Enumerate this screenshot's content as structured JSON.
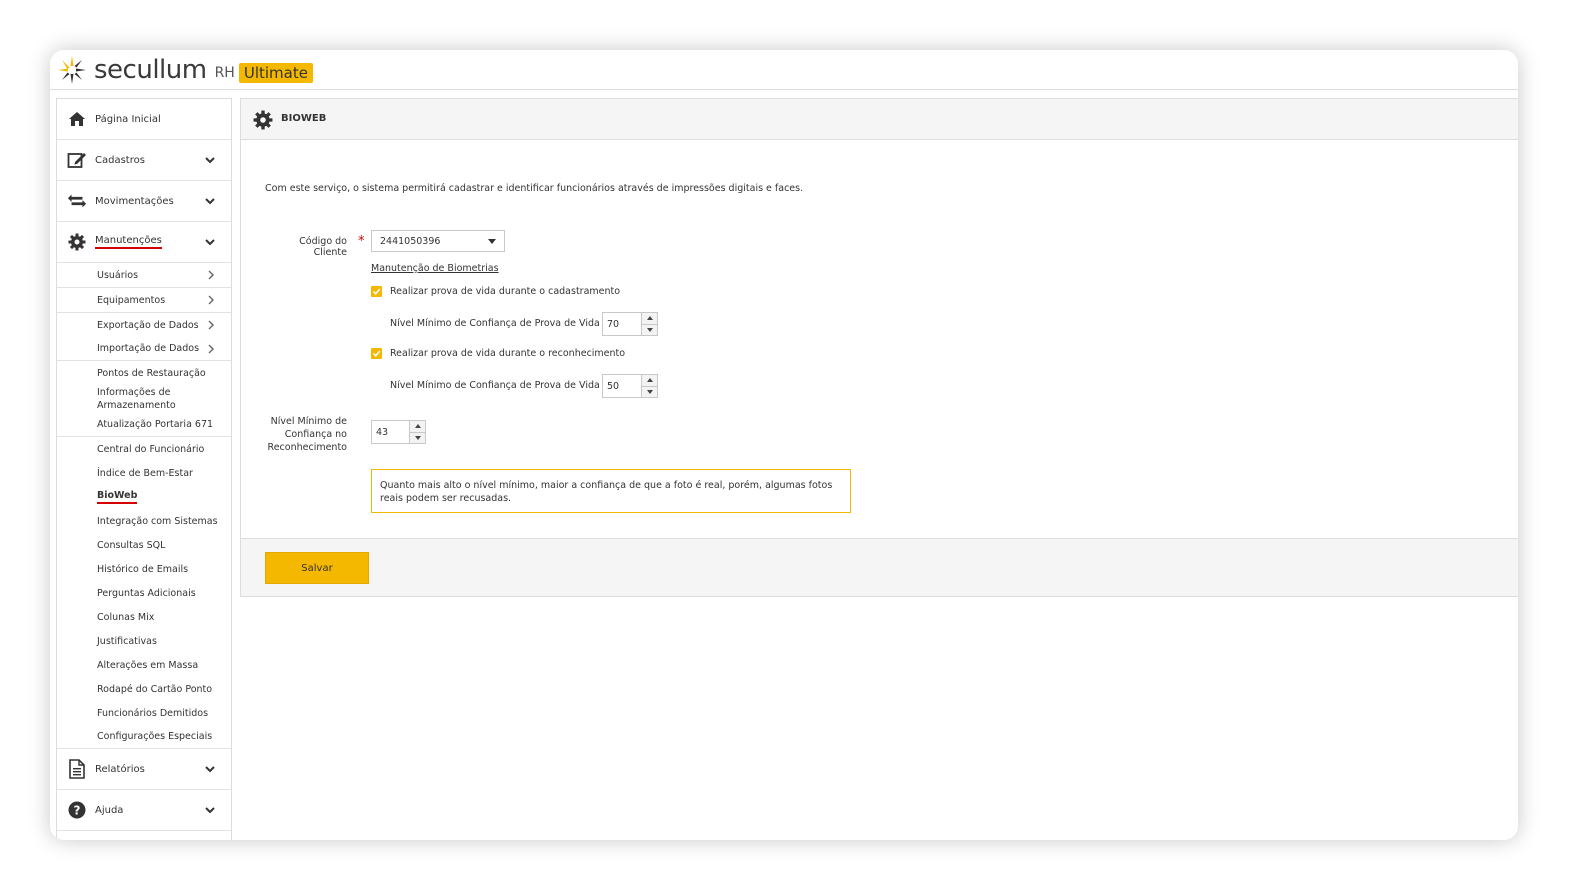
{
  "brand": {
    "name": "secullum",
    "rh": "RH",
    "edition": "Ultimate",
    "accent": "#f5b800"
  },
  "sidebar": {
    "items": [
      {
        "label": "Página Inicial",
        "icon": "home-icon"
      },
      {
        "label": "Cadastros",
        "icon": "edit-icon"
      },
      {
        "label": "Movimentações",
        "icon": "transfer-icon"
      },
      {
        "label": "Manutenções",
        "icon": "gear-icon"
      }
    ],
    "submenu": [
      {
        "label": "Usuários"
      },
      {
        "label": "Equipamentos"
      },
      {
        "label": "Exportação de Dados"
      },
      {
        "label": "Importação de Dados"
      },
      {
        "label": "Pontos de Restauração"
      },
      {
        "label": "Informações de Armazenamento"
      },
      {
        "label": "Atualização Portaria 671"
      },
      {
        "label": "Central do Funcionário"
      },
      {
        "label": "Índice de Bem-Estar"
      },
      {
        "label": "BioWeb"
      },
      {
        "label": "Integração com Sistemas"
      },
      {
        "label": "Consultas SQL"
      },
      {
        "label": "Histórico de Emails"
      },
      {
        "label": "Perguntas Adicionais"
      },
      {
        "label": "Colunas Mix"
      },
      {
        "label": "Justificativas"
      },
      {
        "label": "Alterações em Massa"
      },
      {
        "label": "Rodapé do Cartão Ponto"
      },
      {
        "label": "Funcionários Demitidos"
      },
      {
        "label": "Configurações Especiais"
      }
    ],
    "bottom_items": [
      {
        "label": "Relatórios",
        "icon": "document-icon"
      },
      {
        "label": "Ajuda",
        "icon": "help-icon"
      }
    ]
  },
  "page": {
    "title": "BIOWEB",
    "description": "Com este serviço, o sistema permitirá cadastrar e identificar funcionários através de impressões digitais e faces.",
    "client_code_label": "Código do Cliente",
    "client_code_value": "2441050396",
    "maintenance_link": "Manutenção de Biometrias",
    "check_registration": "Realizar prova de vida durante o cadastramento",
    "liveness_label_1": "Nível Mínimo de Confiança de Prova de Vida",
    "liveness_value_1": "70",
    "check_recognition": "Realizar prova de vida durante o reconhecimento",
    "liveness_label_2": "Nível Mínimo de Confiança de Prova de Vida",
    "liveness_value_2": "50",
    "recognition_label_l1": "Nível Mínimo de",
    "recognition_label_l2": "Confiança no",
    "recognition_label_l3": "Reconhecimento",
    "recognition_value": "43",
    "hint": "Quanto mais alto o nível mínimo, maior a confiança de que a foto é real, porém, algumas fotos reais podem ser recusadas.",
    "save_label": "Salvar"
  }
}
